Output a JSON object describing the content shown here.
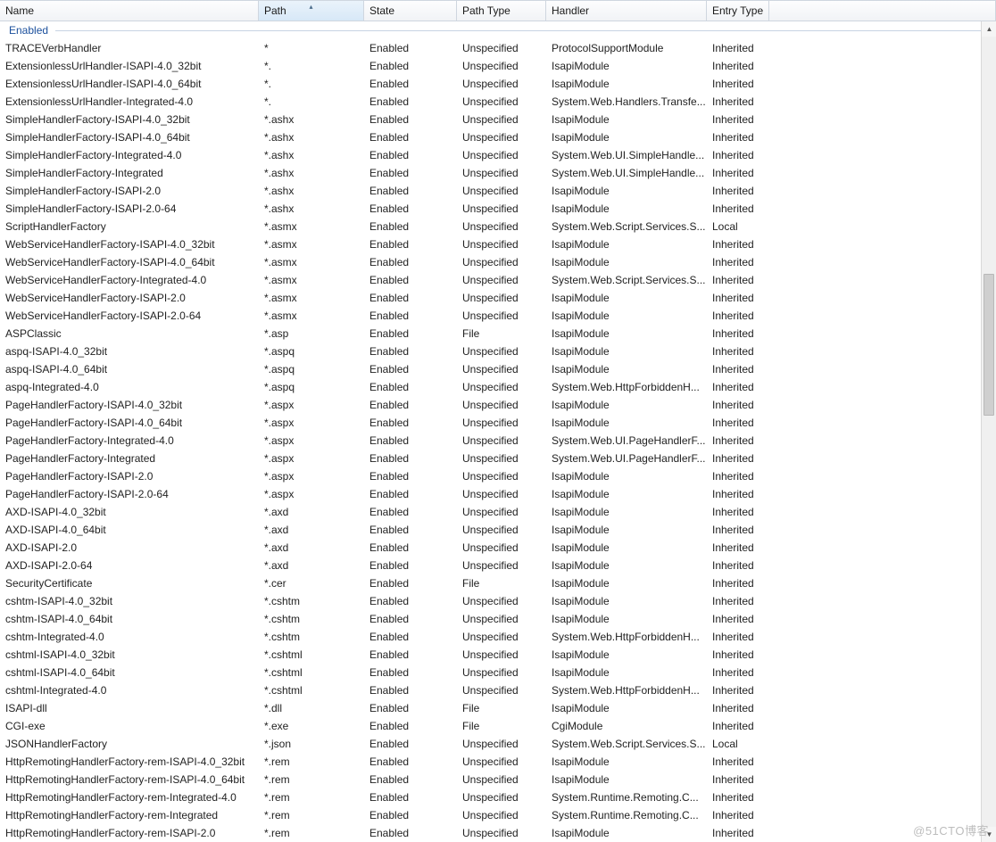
{
  "columns": {
    "name": "Name",
    "path": "Path",
    "state": "State",
    "ptype": "Path Type",
    "handler": "Handler",
    "entry": "Entry Type",
    "sorted": "path",
    "sort_glyph": "▴"
  },
  "group_label": "Enabled",
  "watermark": "@51CTO博客",
  "rows": [
    {
      "name": "TRACEVerbHandler",
      "path": "*",
      "state": "Enabled",
      "ptype": "Unspecified",
      "handler": "ProtocolSupportModule",
      "entry": "Inherited"
    },
    {
      "name": "ExtensionlessUrlHandler-ISAPI-4.0_32bit",
      "path": "*.",
      "state": "Enabled",
      "ptype": "Unspecified",
      "handler": "IsapiModule",
      "entry": "Inherited"
    },
    {
      "name": "ExtensionlessUrlHandler-ISAPI-4.0_64bit",
      "path": "*.",
      "state": "Enabled",
      "ptype": "Unspecified",
      "handler": "IsapiModule",
      "entry": "Inherited"
    },
    {
      "name": "ExtensionlessUrlHandler-Integrated-4.0",
      "path": "*.",
      "state": "Enabled",
      "ptype": "Unspecified",
      "handler": "System.Web.Handlers.Transfe...",
      "entry": "Inherited"
    },
    {
      "name": "SimpleHandlerFactory-ISAPI-4.0_32bit",
      "path": "*.ashx",
      "state": "Enabled",
      "ptype": "Unspecified",
      "handler": "IsapiModule",
      "entry": "Inherited"
    },
    {
      "name": "SimpleHandlerFactory-ISAPI-4.0_64bit",
      "path": "*.ashx",
      "state": "Enabled",
      "ptype": "Unspecified",
      "handler": "IsapiModule",
      "entry": "Inherited"
    },
    {
      "name": "SimpleHandlerFactory-Integrated-4.0",
      "path": "*.ashx",
      "state": "Enabled",
      "ptype": "Unspecified",
      "handler": "System.Web.UI.SimpleHandle...",
      "entry": "Inherited"
    },
    {
      "name": "SimpleHandlerFactory-Integrated",
      "path": "*.ashx",
      "state": "Enabled",
      "ptype": "Unspecified",
      "handler": "System.Web.UI.SimpleHandle...",
      "entry": "Inherited"
    },
    {
      "name": "SimpleHandlerFactory-ISAPI-2.0",
      "path": "*.ashx",
      "state": "Enabled",
      "ptype": "Unspecified",
      "handler": "IsapiModule",
      "entry": "Inherited"
    },
    {
      "name": "SimpleHandlerFactory-ISAPI-2.0-64",
      "path": "*.ashx",
      "state": "Enabled",
      "ptype": "Unspecified",
      "handler": "IsapiModule",
      "entry": "Inherited"
    },
    {
      "name": "ScriptHandlerFactory",
      "path": "*.asmx",
      "state": "Enabled",
      "ptype": "Unspecified",
      "handler": "System.Web.Script.Services.S...",
      "entry": "Local"
    },
    {
      "name": "WebServiceHandlerFactory-ISAPI-4.0_32bit",
      "path": "*.asmx",
      "state": "Enabled",
      "ptype": "Unspecified",
      "handler": "IsapiModule",
      "entry": "Inherited"
    },
    {
      "name": "WebServiceHandlerFactory-ISAPI-4.0_64bit",
      "path": "*.asmx",
      "state": "Enabled",
      "ptype": "Unspecified",
      "handler": "IsapiModule",
      "entry": "Inherited"
    },
    {
      "name": "WebServiceHandlerFactory-Integrated-4.0",
      "path": "*.asmx",
      "state": "Enabled",
      "ptype": "Unspecified",
      "handler": "System.Web.Script.Services.S...",
      "entry": "Inherited"
    },
    {
      "name": "WebServiceHandlerFactory-ISAPI-2.0",
      "path": "*.asmx",
      "state": "Enabled",
      "ptype": "Unspecified",
      "handler": "IsapiModule",
      "entry": "Inherited"
    },
    {
      "name": "WebServiceHandlerFactory-ISAPI-2.0-64",
      "path": "*.asmx",
      "state": "Enabled",
      "ptype": "Unspecified",
      "handler": "IsapiModule",
      "entry": "Inherited"
    },
    {
      "name": "ASPClassic",
      "path": "*.asp",
      "state": "Enabled",
      "ptype": "File",
      "handler": "IsapiModule",
      "entry": "Inherited"
    },
    {
      "name": "aspq-ISAPI-4.0_32bit",
      "path": "*.aspq",
      "state": "Enabled",
      "ptype": "Unspecified",
      "handler": "IsapiModule",
      "entry": "Inherited"
    },
    {
      "name": "aspq-ISAPI-4.0_64bit",
      "path": "*.aspq",
      "state": "Enabled",
      "ptype": "Unspecified",
      "handler": "IsapiModule",
      "entry": "Inherited"
    },
    {
      "name": "aspq-Integrated-4.0",
      "path": "*.aspq",
      "state": "Enabled",
      "ptype": "Unspecified",
      "handler": "System.Web.HttpForbiddenH...",
      "entry": "Inherited"
    },
    {
      "name": "PageHandlerFactory-ISAPI-4.0_32bit",
      "path": "*.aspx",
      "state": "Enabled",
      "ptype": "Unspecified",
      "handler": "IsapiModule",
      "entry": "Inherited"
    },
    {
      "name": "PageHandlerFactory-ISAPI-4.0_64bit",
      "path": "*.aspx",
      "state": "Enabled",
      "ptype": "Unspecified",
      "handler": "IsapiModule",
      "entry": "Inherited"
    },
    {
      "name": "PageHandlerFactory-Integrated-4.0",
      "path": "*.aspx",
      "state": "Enabled",
      "ptype": "Unspecified",
      "handler": "System.Web.UI.PageHandlerF...",
      "entry": "Inherited"
    },
    {
      "name": "PageHandlerFactory-Integrated",
      "path": "*.aspx",
      "state": "Enabled",
      "ptype": "Unspecified",
      "handler": "System.Web.UI.PageHandlerF...",
      "entry": "Inherited"
    },
    {
      "name": "PageHandlerFactory-ISAPI-2.0",
      "path": "*.aspx",
      "state": "Enabled",
      "ptype": "Unspecified",
      "handler": "IsapiModule",
      "entry": "Inherited"
    },
    {
      "name": "PageHandlerFactory-ISAPI-2.0-64",
      "path": "*.aspx",
      "state": "Enabled",
      "ptype": "Unspecified",
      "handler": "IsapiModule",
      "entry": "Inherited"
    },
    {
      "name": "AXD-ISAPI-4.0_32bit",
      "path": "*.axd",
      "state": "Enabled",
      "ptype": "Unspecified",
      "handler": "IsapiModule",
      "entry": "Inherited"
    },
    {
      "name": "AXD-ISAPI-4.0_64bit",
      "path": "*.axd",
      "state": "Enabled",
      "ptype": "Unspecified",
      "handler": "IsapiModule",
      "entry": "Inherited"
    },
    {
      "name": "AXD-ISAPI-2.0",
      "path": "*.axd",
      "state": "Enabled",
      "ptype": "Unspecified",
      "handler": "IsapiModule",
      "entry": "Inherited"
    },
    {
      "name": "AXD-ISAPI-2.0-64",
      "path": "*.axd",
      "state": "Enabled",
      "ptype": "Unspecified",
      "handler": "IsapiModule",
      "entry": "Inherited"
    },
    {
      "name": "SecurityCertificate",
      "path": "*.cer",
      "state": "Enabled",
      "ptype": "File",
      "handler": "IsapiModule",
      "entry": "Inherited"
    },
    {
      "name": "cshtm-ISAPI-4.0_32bit",
      "path": "*.cshtm",
      "state": "Enabled",
      "ptype": "Unspecified",
      "handler": "IsapiModule",
      "entry": "Inherited"
    },
    {
      "name": "cshtm-ISAPI-4.0_64bit",
      "path": "*.cshtm",
      "state": "Enabled",
      "ptype": "Unspecified",
      "handler": "IsapiModule",
      "entry": "Inherited"
    },
    {
      "name": "cshtm-Integrated-4.0",
      "path": "*.cshtm",
      "state": "Enabled",
      "ptype": "Unspecified",
      "handler": "System.Web.HttpForbiddenH...",
      "entry": "Inherited"
    },
    {
      "name": "cshtml-ISAPI-4.0_32bit",
      "path": "*.cshtml",
      "state": "Enabled",
      "ptype": "Unspecified",
      "handler": "IsapiModule",
      "entry": "Inherited"
    },
    {
      "name": "cshtml-ISAPI-4.0_64bit",
      "path": "*.cshtml",
      "state": "Enabled",
      "ptype": "Unspecified",
      "handler": "IsapiModule",
      "entry": "Inherited"
    },
    {
      "name": "cshtml-Integrated-4.0",
      "path": "*.cshtml",
      "state": "Enabled",
      "ptype": "Unspecified",
      "handler": "System.Web.HttpForbiddenH...",
      "entry": "Inherited"
    },
    {
      "name": "ISAPI-dll",
      "path": "*.dll",
      "state": "Enabled",
      "ptype": "File",
      "handler": "IsapiModule",
      "entry": "Inherited"
    },
    {
      "name": "CGI-exe",
      "path": "*.exe",
      "state": "Enabled",
      "ptype": "File",
      "handler": "CgiModule",
      "entry": "Inherited"
    },
    {
      "name": "JSONHandlerFactory",
      "path": "*.json",
      "state": "Enabled",
      "ptype": "Unspecified",
      "handler": "System.Web.Script.Services.S...",
      "entry": "Local"
    },
    {
      "name": "HttpRemotingHandlerFactory-rem-ISAPI-4.0_32bit",
      "path": "*.rem",
      "state": "Enabled",
      "ptype": "Unspecified",
      "handler": "IsapiModule",
      "entry": "Inherited"
    },
    {
      "name": "HttpRemotingHandlerFactory-rem-ISAPI-4.0_64bit",
      "path": "*.rem",
      "state": "Enabled",
      "ptype": "Unspecified",
      "handler": "IsapiModule",
      "entry": "Inherited"
    },
    {
      "name": "HttpRemotingHandlerFactory-rem-Integrated-4.0",
      "path": "*.rem",
      "state": "Enabled",
      "ptype": "Unspecified",
      "handler": "System.Runtime.Remoting.C...",
      "entry": "Inherited"
    },
    {
      "name": "HttpRemotingHandlerFactory-rem-Integrated",
      "path": "*.rem",
      "state": "Enabled",
      "ptype": "Unspecified",
      "handler": "System.Runtime.Remoting.C...",
      "entry": "Inherited"
    },
    {
      "name": "HttpRemotingHandlerFactory-rem-ISAPI-2.0",
      "path": "*.rem",
      "state": "Enabled",
      "ptype": "Unspecified",
      "handler": "IsapiModule",
      "entry": "Inherited"
    }
  ]
}
